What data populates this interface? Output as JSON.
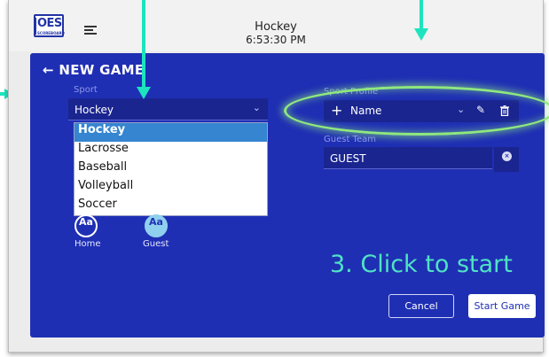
{
  "app": {
    "logo_text": "OES",
    "logo_subtext": "SCOREBOARD",
    "title": "Hockey",
    "time": "6:53:30 PM"
  },
  "dialog": {
    "title": "← NEW GAME",
    "sport": {
      "label": "Sport",
      "value": "Hockey",
      "options": [
        "Hockey",
        "Lacrosse",
        "Baseball",
        "Volleyball",
        "Soccer"
      ]
    },
    "team_icons": {
      "home": {
        "glyph": "Aa",
        "label": "Home"
      },
      "guest": {
        "glyph": "Aa",
        "label": "Guest"
      }
    },
    "sport_profile": {
      "label": "Sport Profile",
      "add_glyph": "+",
      "value": "Name"
    },
    "guest_team": {
      "label": "Guest Team",
      "value": "GUEST",
      "clear_glyph": "×"
    },
    "annotation": "3. Click to start",
    "cancel_label": "Cancel",
    "start_label": "Start Game"
  },
  "colors": {
    "dialog_bg": "#1f2fb4",
    "accent_arrow": "#1de4bf",
    "highlight": "#8fe87e",
    "selected_option": "#3585d1"
  },
  "icons": [
    "menu-icon",
    "back-arrow-icon",
    "chevron-down-icon",
    "plus-icon",
    "pencil-icon",
    "trash-icon",
    "clear-icon"
  ]
}
